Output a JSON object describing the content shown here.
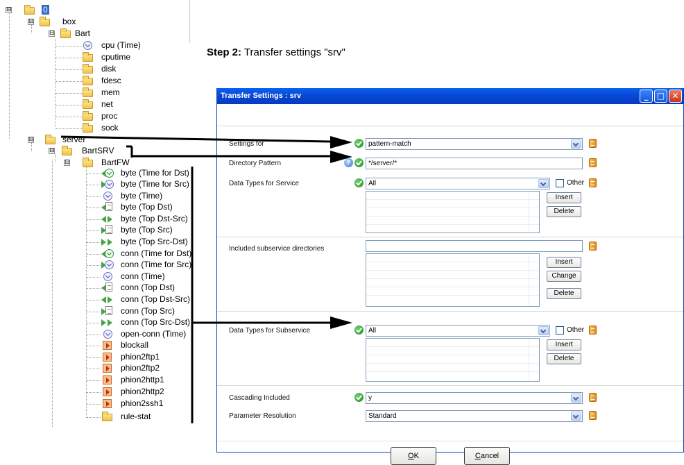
{
  "tree": {
    "nodes": [
      {
        "label": "0",
        "icon": "folder-icon",
        "expander": "⊟",
        "selected": true
      },
      {
        "label": "box",
        "icon": "folder-icon",
        "expander": "⊟"
      },
      {
        "label": "Bart",
        "icon": "folder-icon",
        "expander": "⊟"
      },
      {
        "label": "cpu (Time)",
        "icon": "clock-icon"
      },
      {
        "label": "cputime",
        "icon": "folder-icon"
      },
      {
        "label": "disk",
        "icon": "folder-icon"
      },
      {
        "label": "fdesc",
        "icon": "folder-icon"
      },
      {
        "label": "mem",
        "icon": "folder-icon"
      },
      {
        "label": "net",
        "icon": "folder-icon"
      },
      {
        "label": "proc",
        "icon": "folder-icon"
      },
      {
        "label": "sock",
        "icon": "folder-icon"
      },
      {
        "label": "server",
        "icon": "folder-icon",
        "expander": "⊟"
      },
      {
        "label": "BartSRV",
        "icon": "folder-icon",
        "expander": "⊟"
      },
      {
        "label": "BartFW",
        "icon": "folder-icon",
        "expander": "⊟"
      },
      {
        "label": "byte (Time for Dst)",
        "icon": "time-dst-icon"
      },
      {
        "label": "byte (Time for Src)",
        "icon": "time-src-icon"
      },
      {
        "label": "byte (Time)",
        "icon": "clock-icon"
      },
      {
        "label": "byte (Top Dst)",
        "icon": "top-dst-icon"
      },
      {
        "label": "byte (Top Dst-Src)",
        "icon": "top-dst-src-icon"
      },
      {
        "label": "byte (Top Src)",
        "icon": "top-src-icon"
      },
      {
        "label": "byte (Top Src-Dst)",
        "icon": "top-src-dst-icon"
      },
      {
        "label": "conn (Time for Dst)",
        "icon": "time-dst-icon"
      },
      {
        "label": "conn (Time for Src)",
        "icon": "time-src-icon"
      },
      {
        "label": "conn (Time)",
        "icon": "clock-icon"
      },
      {
        "label": "conn (Top Dst)",
        "icon": "top-dst-icon"
      },
      {
        "label": "conn (Top Dst-Src)",
        "icon": "top-dst-src-icon"
      },
      {
        "label": "conn (Top Src)",
        "icon": "top-src-icon"
      },
      {
        "label": "conn (Top Src-Dst)",
        "icon": "top-src-dst-icon"
      },
      {
        "label": "open-conn (Time)",
        "icon": "clock-icon"
      },
      {
        "label": "blockall",
        "icon": "rule-icon"
      },
      {
        "label": "phion2ftp1",
        "icon": "rule-icon"
      },
      {
        "label": "phion2ftp2",
        "icon": "rule-icon"
      },
      {
        "label": "phion2http1",
        "icon": "rule-icon"
      },
      {
        "label": "phion2http2",
        "icon": "rule-icon"
      },
      {
        "label": "phion2ssh1",
        "icon": "rule-icon"
      },
      {
        "label": "rule-stat",
        "icon": "folder-icon"
      }
    ]
  },
  "step": {
    "prefix": "Step 2:",
    "text": " Transfer settings \"srv\""
  },
  "window": {
    "title": "Transfer Settings : srv",
    "controls": {
      "minimize": "_",
      "maximize": "□",
      "close": "✕"
    }
  },
  "form": {
    "settings_for": {
      "label": "Settings for",
      "value": "pattern-match"
    },
    "directory_pattern": {
      "label": "Directory Pattern",
      "value": "*/server/*",
      "help": "?"
    },
    "data_types_service": {
      "label": "Data Types for Service",
      "value": "All",
      "other_label": "Other",
      "other_checked": false,
      "insert": "Insert",
      "delete": "Delete"
    },
    "included_subservice": {
      "label": "Included subservice directories",
      "value": "",
      "insert": "Insert",
      "change": "Change",
      "delete": "Delete"
    },
    "data_types_subservice": {
      "label": "Data Types for Subservice",
      "value": "All",
      "other_label": "Other",
      "other_checked": false,
      "insert": "Insert",
      "delete": "Delete"
    },
    "cascading_included": {
      "label": "Cascading Included",
      "value": "y"
    },
    "parameter_resolution": {
      "label": "Parameter Resolution",
      "value": "Standard"
    }
  },
  "buttons": {
    "ok": {
      "mnemonic": "O",
      "rest": "K"
    },
    "cancel": {
      "mnemonic": "C",
      "rest": "ancel"
    }
  },
  "colors": {
    "titlebar": "#0748d6",
    "selection": "#316ac5",
    "ok_icon": "#2a9a2a",
    "connector": "#000000"
  }
}
